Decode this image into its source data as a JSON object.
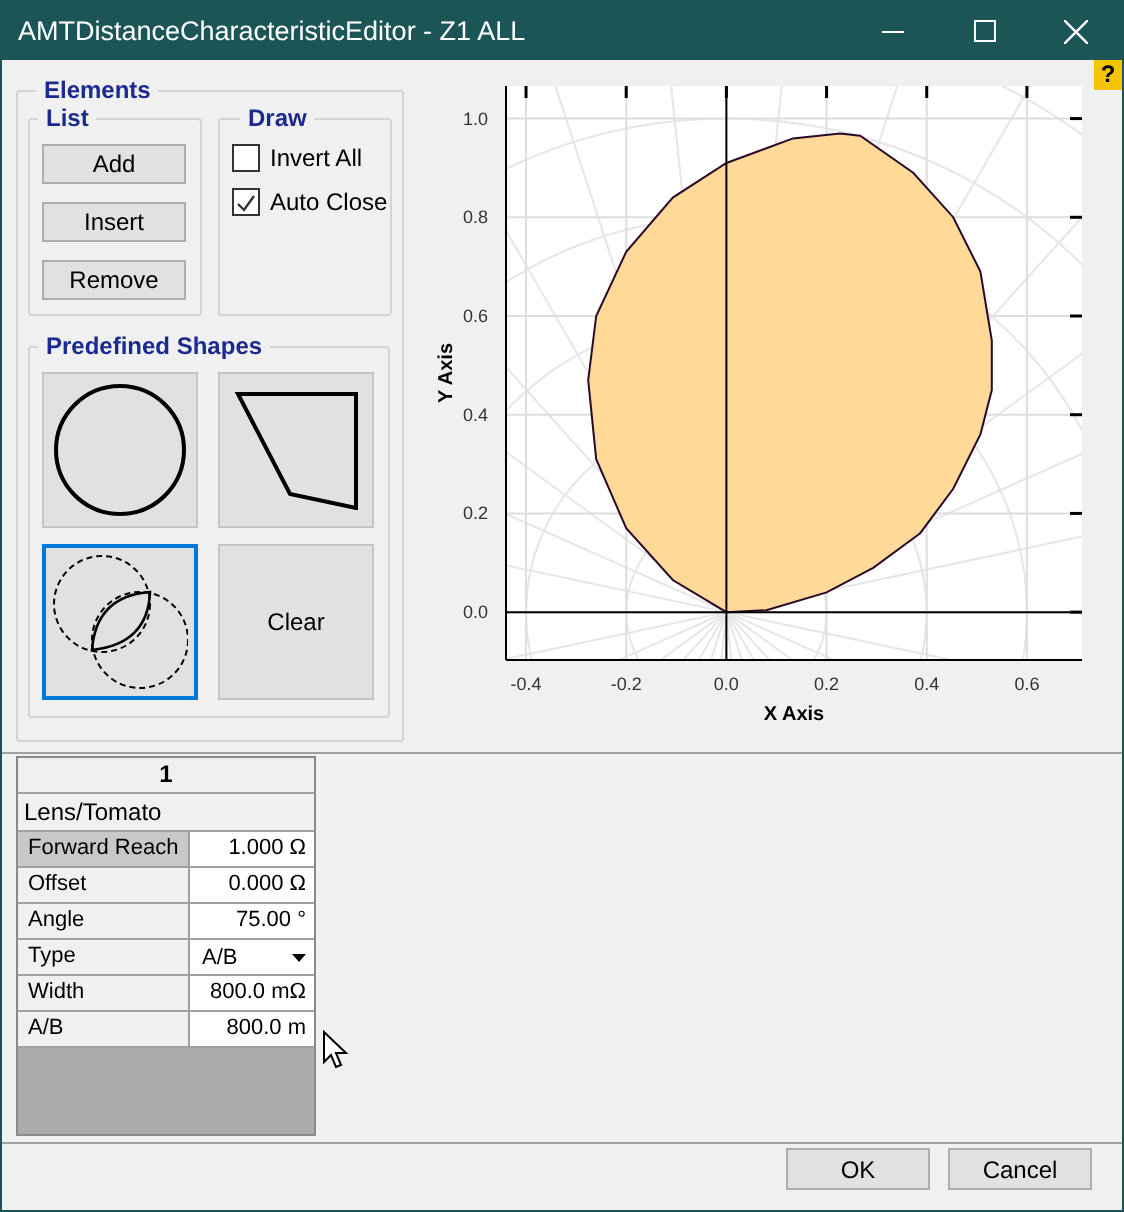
{
  "window": {
    "title": "AMTDistanceCharacteristicEditor - Z1 ALL",
    "help": "?"
  },
  "elements": {
    "title": "Elements",
    "list": {
      "title": "List",
      "buttons": [
        "Add",
        "Insert",
        "Remove"
      ]
    },
    "draw": {
      "title": "Draw",
      "options": [
        {
          "label": "Invert All",
          "checked": false
        },
        {
          "label": "Auto Close",
          "checked": true
        }
      ]
    },
    "predefined_shapes": {
      "title": "Predefined Shapes",
      "shapes": [
        {
          "kind": "circle",
          "selected": false
        },
        {
          "kind": "quadrilateral",
          "selected": false
        },
        {
          "kind": "lens",
          "selected": true
        },
        {
          "kind": "clear",
          "label": "Clear",
          "selected": false
        }
      ]
    }
  },
  "chart": {
    "chart_data": {
      "type": "area",
      "grid": true,
      "xlabel": "X Axis",
      "ylabel": "Y Axis",
      "xlim": [
        -0.44,
        0.71
      ],
      "ylim": [
        -0.097,
        1.066
      ],
      "x": [
        0,
        0.08,
        0.2,
        0.293,
        0.387,
        0.453,
        0.507,
        0.53,
        0.53,
        0.507,
        0.453,
        0.373,
        0.267,
        0.227,
        0.133,
        0,
        -0.107,
        -0.2,
        -0.26,
        -0.276,
        -0.26,
        -0.2,
        -0.107,
        0
      ],
      "series": [
        {
          "color": "#ffd998",
          "values": [
            0,
            0.004,
            0.04,
            0.09,
            0.16,
            0.25,
            0.36,
            0.45,
            0.55,
            0.69,
            0.8,
            0.89,
            0.965,
            0.97,
            0.96,
            0.91,
            0.84,
            0.73,
            0.6,
            0.47,
            0.31,
            0.17,
            0.065,
            0
          ]
        }
      ],
      "xticks": [
        {
          "value": -0.4,
          "label": "-0.4"
        },
        {
          "value": -0.2,
          "label": "-0.2"
        },
        {
          "value": 0,
          "label": "0.0"
        },
        {
          "value": 0.2,
          "label": "0.2"
        },
        {
          "value": 0.4,
          "label": "0.4"
        },
        {
          "value": 0.6,
          "label": "0.6"
        }
      ],
      "yticks": [
        {
          "value": 0,
          "label": "0.0"
        },
        {
          "value": 0.2,
          "label": "0.2"
        },
        {
          "value": 0.4,
          "label": "0.4"
        },
        {
          "value": 0.6,
          "label": "0.6"
        },
        {
          "value": 0.8,
          "label": "0.8"
        },
        {
          "value": 1,
          "label": "1.0"
        }
      ]
    }
  },
  "property_grid": {
    "column": "1",
    "category": "Lens/Tomato",
    "rows": [
      {
        "name": "Forward Reach",
        "value": "1.000 Ω",
        "kind": "text",
        "selected": true
      },
      {
        "name": "Offset",
        "value": "0.000 Ω",
        "kind": "text",
        "selected": false
      },
      {
        "name": "Angle",
        "value": "75.00 °",
        "kind": "text",
        "selected": false
      },
      {
        "name": "Type",
        "value": "A/B",
        "kind": "dropdown",
        "selected": false
      },
      {
        "name": "Width",
        "value": "800.0 mΩ",
        "kind": "text",
        "selected": false
      },
      {
        "name": "A/B",
        "value": "800.0 m",
        "kind": "text",
        "selected": false
      }
    ]
  },
  "buttons": [
    "OK",
    "Cancel"
  ]
}
